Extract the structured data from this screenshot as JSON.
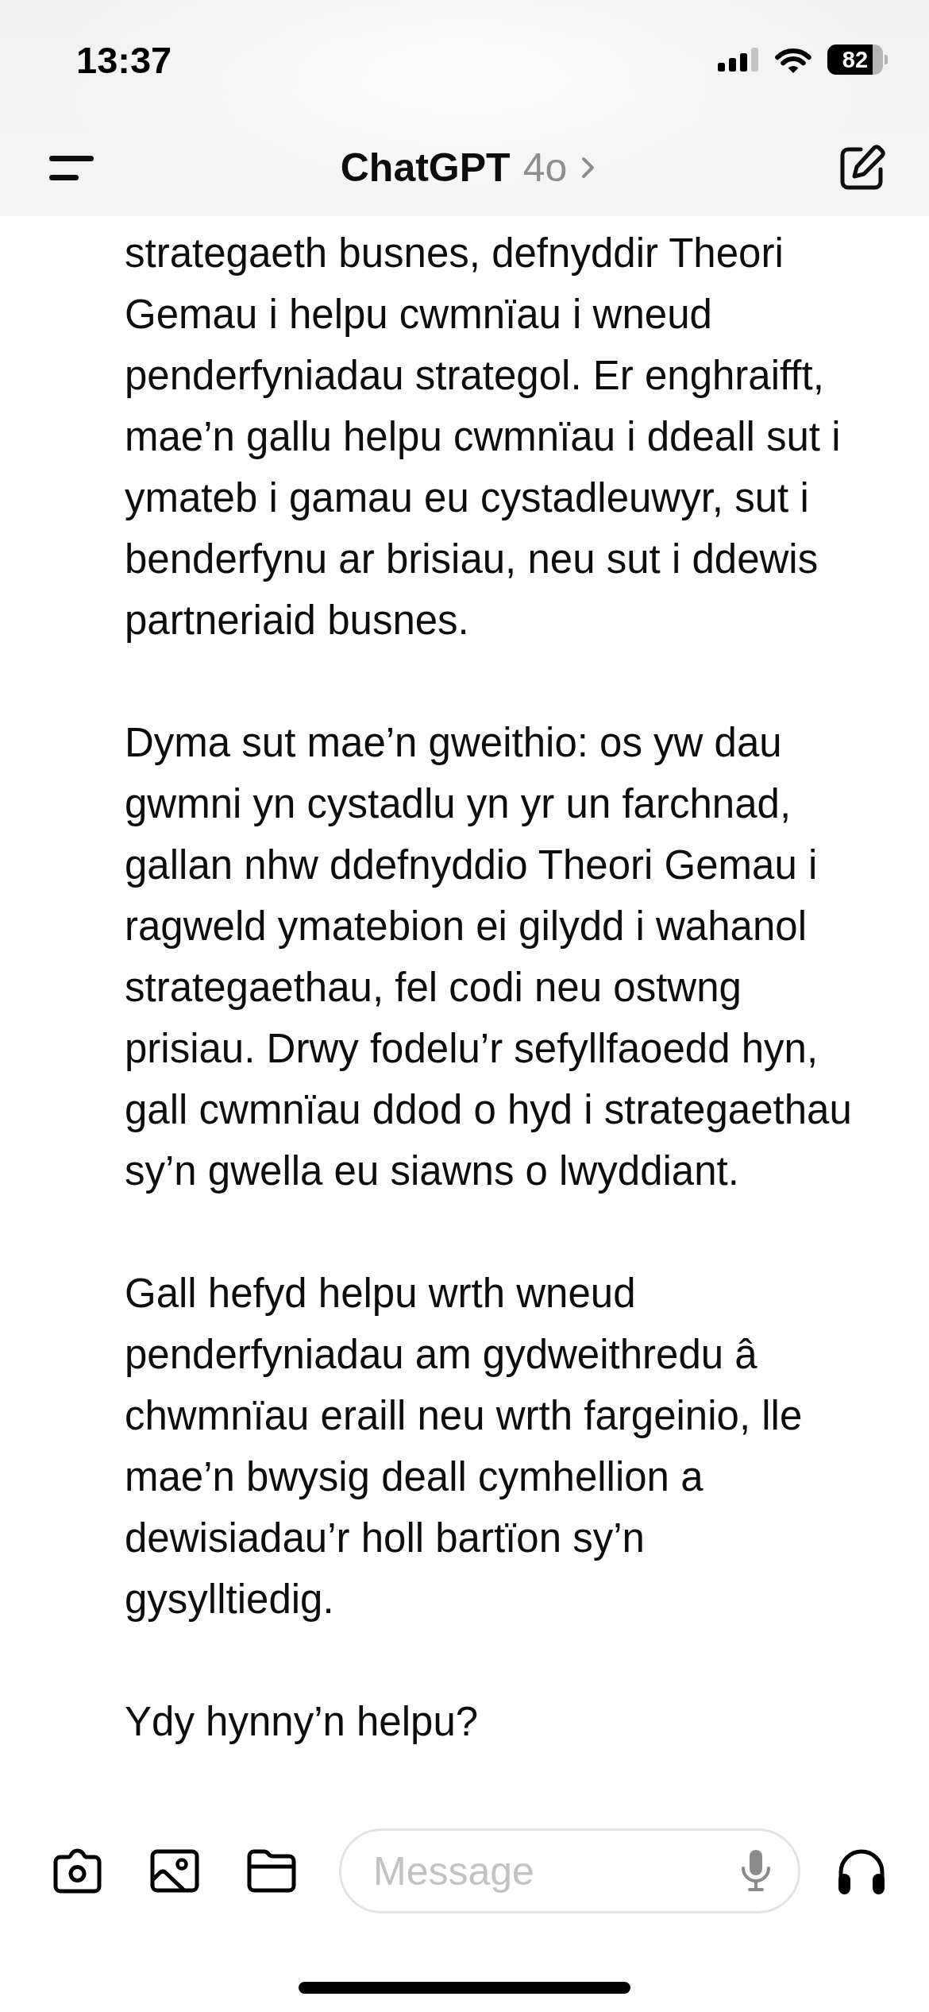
{
  "status_bar": {
    "time": "13:37",
    "battery": "82"
  },
  "header": {
    "title": "ChatGPT",
    "model": "4o"
  },
  "message": {
    "paragraphs": [
      {
        "lines": [
          "strategaeth busnes, defnyddir Theori",
          "Gemau i helpu cwmnïau i wneud",
          "penderfyniadau strategol. Er enghraifft,",
          "mae’n gallu helpu cwmnïau i ddeall sut i",
          "ymateb i gamau eu cystadleuwyr, sut i",
          "benderfynu ar brisiau, neu sut i ddewis",
          "partneriaid busnes."
        ]
      },
      {
        "lines": [
          "Dyma sut mae’n gweithio: os yw dau",
          "gwmni yn cystadlu yn yr un farchnad,",
          "gallan nhw ddefnyddio Theori Gemau i",
          "ragweld ymatebion ei gilydd i wahanol",
          "strategaethau, fel codi neu ostwng",
          "prisiau. Drwy fodelu’r sefyllfaoedd hyn,",
          "gall cwmnïau ddod o hyd i strategaethau",
          "sy’n gwella eu siawns o lwyddiant."
        ]
      },
      {
        "lines": [
          "Gall hefyd helpu wrth wneud",
          "penderfyniadau am gydweithredu â",
          "chwmnïau eraill neu wrth fargeinio, lle",
          "mae’n bwysig deall cymhellion a",
          "dewisiadau’r holl bartïon sy’n",
          "gysylltiedig."
        ]
      },
      {
        "lines": [
          "Ydy hynny’n helpu?"
        ]
      }
    ]
  },
  "composer": {
    "placeholder": "Message"
  }
}
